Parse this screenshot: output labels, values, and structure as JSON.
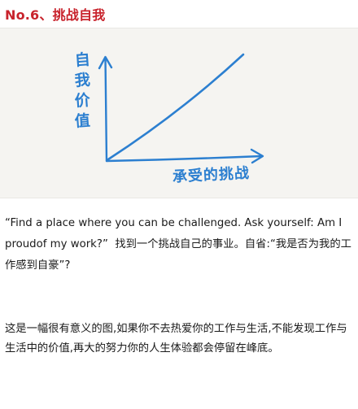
{
  "heading": "No.6、挑战自我",
  "sketch": {
    "y_axis_label": [
      "自",
      "我",
      "价",
      "值"
    ],
    "x_axis_label": "承受的挑战",
    "ink_color": "#2c7fd0"
  },
  "body": {
    "quote_en": "“Find a place where you can be challenged. Ask yourself: Am I proudof my work?”",
    "quote_cn": "找到一个挑战自己的事业。自省:“我是否为我的工作感到自豪”?",
    "paragraph": "这是一幅很有意义的图,如果你不去热爱你的工作与生活,不能发现工作与生活中的价值,再大的努力你的人生体验都会停留在峰底。"
  },
  "colors": {
    "heading": "#c8232c",
    "sketch_background": "#f5f4f1",
    "text": "#1a1a1a"
  }
}
